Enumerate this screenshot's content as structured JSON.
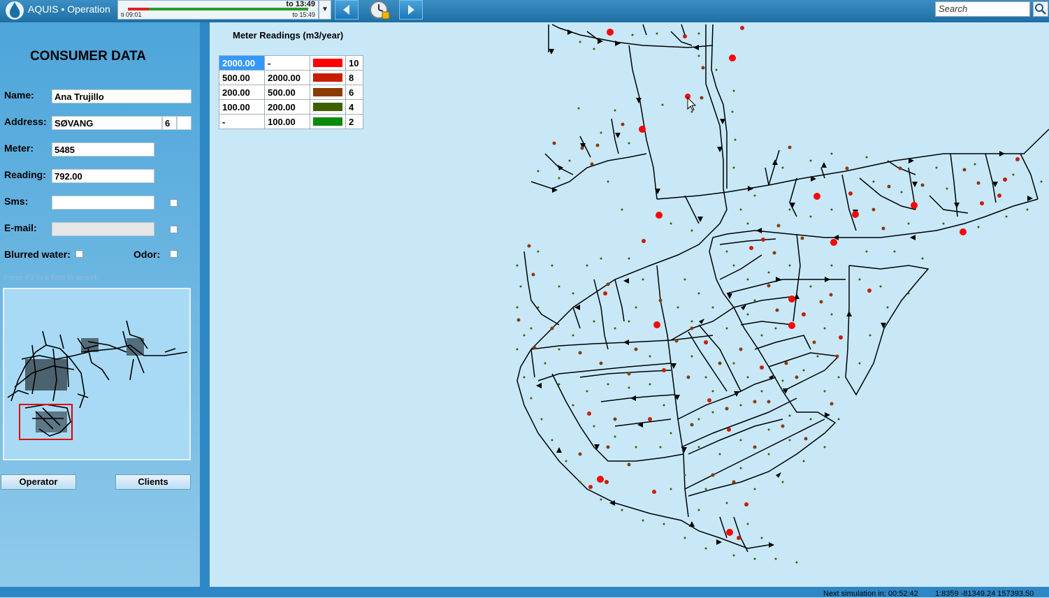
{
  "app": {
    "name": "AQUIS • Operation"
  },
  "timebar": {
    "from": "ti 09:01",
    "to": "to 15:49",
    "now": "to 13:49"
  },
  "search": {
    "placeholder": "Search"
  },
  "consumer": {
    "title": "CONSUMER DATA",
    "name_label": "Name:",
    "name_value": "Ana Trujillo",
    "address_label": "Address:",
    "address_street": "SØVANG",
    "address_number": "6",
    "address_extra": "",
    "meter_label": "Meter:",
    "meter_value": "5485",
    "reading_label": "Reading:",
    "reading_value": "792.00",
    "sms_label": "Sms:",
    "sms_value": "",
    "email_label": "E-mail:",
    "email_value": "",
    "blurred_label": "Blurred water:",
    "odor_label": "Odor:",
    "hint": "Press F3 in a field to search"
  },
  "buttons": {
    "operator": "Operator",
    "clients": "Clients"
  },
  "legend": {
    "title": "Meter Readings (m3/year)",
    "rows": [
      {
        "from": "2000.00",
        "to": "-",
        "color": "#ff0000",
        "size": "10"
      },
      {
        "from": "500.00",
        "to": "2000.00",
        "color": "#c81e00",
        "size": "8"
      },
      {
        "from": "200.00",
        "to": "500.00",
        "color": "#8b3a00",
        "size": "6"
      },
      {
        "from": "100.00",
        "to": "200.00",
        "color": "#3f5f00",
        "size": "4"
      },
      {
        "from": "-",
        "to": "100.00",
        "color": "#0a8a0a",
        "size": "2"
      }
    ]
  },
  "status": {
    "next_sim": "Next simulation in: 00:52:42",
    "coords": "1:8359 -81349.24 157393.50"
  },
  "colors": {
    "accent": "#2d87c4",
    "map_bg": "#c8e8f8",
    "pipe": "#000000"
  }
}
